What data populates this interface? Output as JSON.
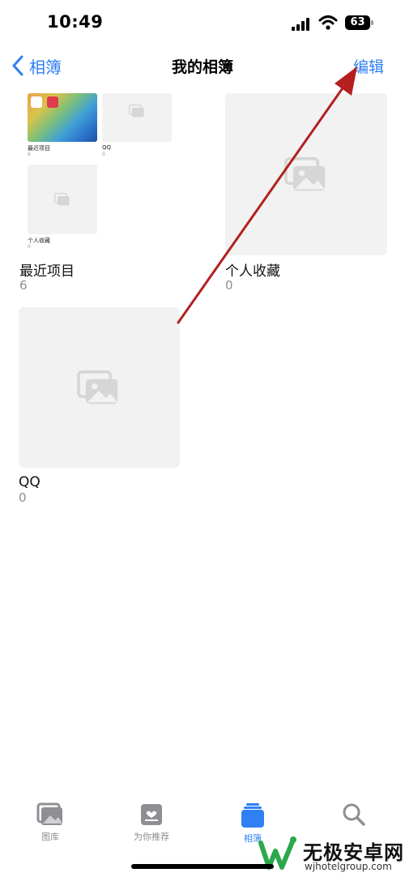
{
  "status_bar": {
    "time": "10:49",
    "battery": "63"
  },
  "nav": {
    "back_label": "相簿",
    "title": "我的相簿",
    "edit_label": "编辑"
  },
  "albums": [
    {
      "name": "最近项目",
      "count": "6",
      "mini_albums": [
        {
          "name": "最近项目",
          "count": "6"
        },
        {
          "name": "QQ",
          "count": "0"
        },
        {
          "name": "个人收藏",
          "count": "0"
        }
      ]
    },
    {
      "name": "个人收藏",
      "count": "0"
    },
    {
      "name": "QQ",
      "count": "0"
    }
  ],
  "tabs": [
    {
      "label": "图库",
      "icon": "photo-library-icon",
      "active": false
    },
    {
      "label": "为你推荐",
      "icon": "for-you-icon",
      "active": false
    },
    {
      "label": "相簿",
      "icon": "albums-icon",
      "active": true
    },
    {
      "label": "",
      "icon": "search-icon",
      "active": false
    }
  ],
  "watermark": {
    "brand": "无极安卓网",
    "url": "wjhotelgroup.com"
  },
  "colors": {
    "accent": "#2f7ff5",
    "annotation_arrow": "#b3201f",
    "tile_bg": "#f2f2f2"
  }
}
